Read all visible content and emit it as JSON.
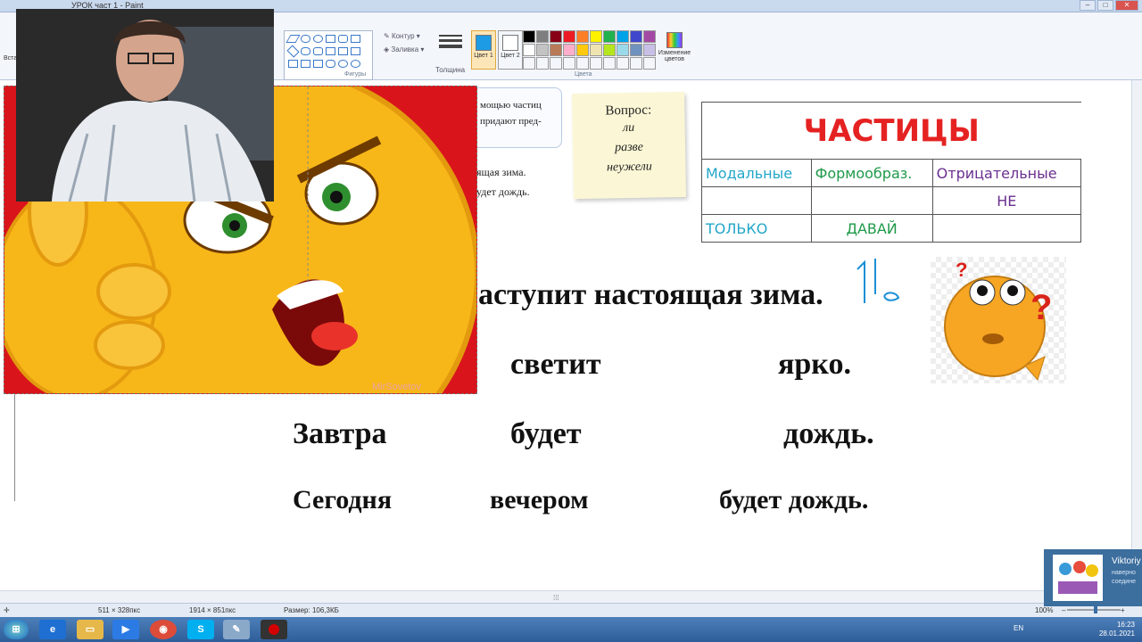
{
  "window": {
    "title": "УРОК част 1 - Paint",
    "controls": [
      "–",
      "□",
      "✕"
    ]
  },
  "ribbon": {
    "paste_label": "Вста",
    "outline_label": "Контур",
    "fill_label": "Заливка",
    "shapes_group": "Фигуры",
    "thickness_label": "Толщина",
    "color1_label": "Цвет 1",
    "color2_label": "Цвет 2",
    "colors_group": "Цвета",
    "edit_colors_label": "Изменение цветов",
    "palette": [
      "#000000",
      "#7f7f7f",
      "#880015",
      "#ed1c24",
      "#ff7f27",
      "#fff200",
      "#22b14c",
      "#00a2e8",
      "#3f48cc",
      "#a349a4",
      "#ffffff",
      "#c3c3c3",
      "#b97a57",
      "#ffaec9",
      "#ffc90e",
      "#efe4b0",
      "#b5e61d",
      "#99d9ea",
      "#7092be",
      "#c8bfe7",
      "#f3f6fb",
      "#f3f6fb",
      "#f3f6fb",
      "#f3f6fb",
      "#f3f6fb",
      "#f3f6fb",
      "#f3f6fb",
      "#f3f6fb",
      "#f3f6fb",
      "#f3f6fb"
    ],
    "color1": "#1e9be5",
    "color2": "#ffffff"
  },
  "slide": {
    "textbox_top_lines": [
      "мощью частиц",
      "придают пред-"
    ],
    "textbox_bottom_lines": [
      "ящая зима.",
      "удет дождь."
    ],
    "note": {
      "question": "Вопрос:",
      "answers": [
        "ли",
        "разве",
        "неужели"
      ]
    },
    "table": {
      "title": "ЧАСТИЦЫ",
      "headers": [
        "Модальные",
        "Формообраз.",
        "Отрицательные"
      ],
      "row1": [
        "",
        "",
        "НЕ"
      ],
      "row2": [
        "ТОЛЬКО",
        "ДАВАЙ",
        ""
      ]
    },
    "sentences": {
      "line1": "аступит настоящая зима.",
      "line2_word1": "светит",
      "line2_word2": "ярко.",
      "line3_word1": "Завтра",
      "line3_word2": "будет",
      "line3_word3": "дождь.",
      "line4_word1": "Сегодня",
      "line4_word2": "вечером",
      "line4_word3": "будет дождь."
    },
    "watermark": "MirSovetov"
  },
  "statusbar": {
    "selection_size": "511 × 328пкс",
    "image_size": "1914 × 851пкс",
    "file_size": "Размер: 106,3КБ",
    "zoom": "100%"
  },
  "notification": {
    "name": "Viktoriy",
    "line1": "наверно",
    "line2": "соедине"
  },
  "taskbar": {
    "language": "EN",
    "time": "16:23",
    "date": "28.01.2021"
  }
}
